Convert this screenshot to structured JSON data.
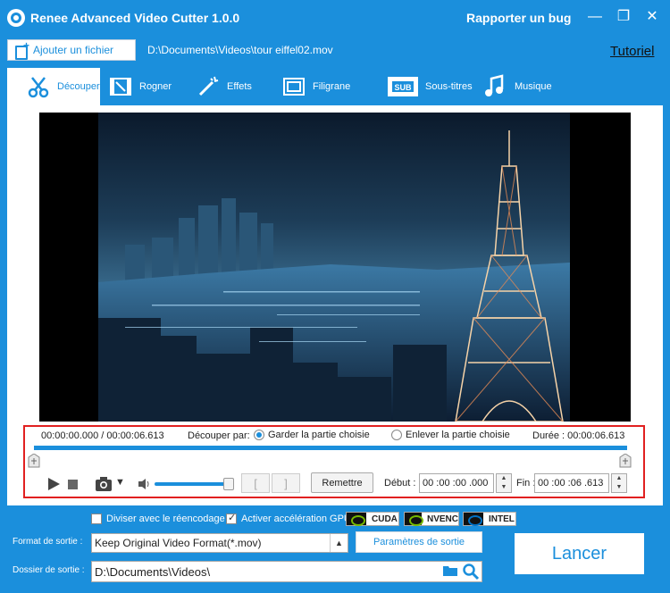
{
  "window": {
    "title": "Renee Advanced Video Cutter 1.0.0",
    "report_bug": "Rapporter un bug",
    "minimize": "—",
    "restore": "❐",
    "close": "✕"
  },
  "toolbar": {
    "add_file": "Ajouter un fichier",
    "file_path": "D:\\Documents\\Videos\\tour eiffel02.mov",
    "tutorial": "Tutoriel"
  },
  "tabs": [
    {
      "label": "Découper",
      "icon": "scissors-icon",
      "active": true
    },
    {
      "label": "Rogner",
      "icon": "crop-film-icon",
      "active": false
    },
    {
      "label": "Effets",
      "icon": "magic-wand-icon",
      "active": false
    },
    {
      "label": "Filigrane",
      "icon": "watermark-icon",
      "active": false
    },
    {
      "label": "Sous-titres",
      "icon": "subtitle-icon",
      "active": false
    },
    {
      "label": "Musique",
      "icon": "music-icon",
      "active": false
    }
  ],
  "cut": {
    "current_time": "00:00:00.000 / 00:00:06.613",
    "cut_by": "Découper par:",
    "keep_option": "Garder la partie choisie",
    "remove_option": "Enlever la partie choisie",
    "selected_option": "keep",
    "duration": "Durée : 00:00:06.613",
    "reset": "Remettre",
    "start_label": "Début :",
    "start_value": "00 :00 :00 .000",
    "end_label": "Fin :",
    "end_value": "00 :00 :06 .613",
    "bracket_open": "[",
    "bracket_close": "]",
    "volume_level": 0.95,
    "camera_dropdown": "▼"
  },
  "options": {
    "split_reencode": "Diviser avec le réencodage",
    "split_reencode_checked": false,
    "gpu_accel": "Activer accélération GPU",
    "gpu_accel_checked": true,
    "gpu_badges": [
      "CUDA",
      "NVENC",
      "INTEL"
    ]
  },
  "output": {
    "format_label": "Format de sortie :",
    "format_value": "Keep Original Video Format(*.mov)",
    "params_button": "Paramètres de sortie",
    "folder_label": "Dossier de sortie :",
    "folder_value": "D:\\Documents\\Videos\\",
    "run_button": "Lancer"
  },
  "colors": {
    "accent": "#1b8fdc",
    "highlight_border": "#e12020"
  }
}
